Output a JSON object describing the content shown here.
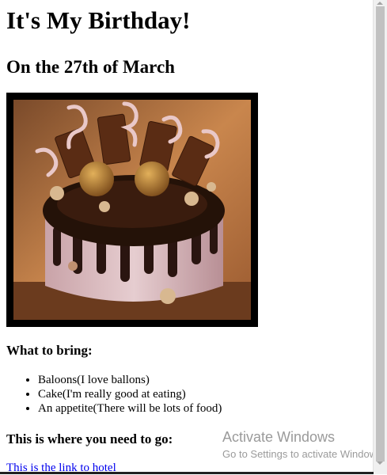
{
  "page": {
    "title": "It's My Birthday!",
    "subtitle": "On the 27th of March",
    "bring_heading": "What to bring:",
    "bring_items": [
      "Baloons(I love ballons)",
      "Cake(I'm really good at eating)",
      "An appetite(There will be lots of food)"
    ],
    "where_heading": "This is where you need to go:",
    "link_text": "This is the link to hotel"
  },
  "watermark": {
    "title": "Activate Windows",
    "subtitle": "Go to Settings to activate Windows."
  },
  "colors": {
    "link": "#0000ee",
    "frame": "#000000",
    "scrollbar_thumb": "#c1c1c1"
  }
}
